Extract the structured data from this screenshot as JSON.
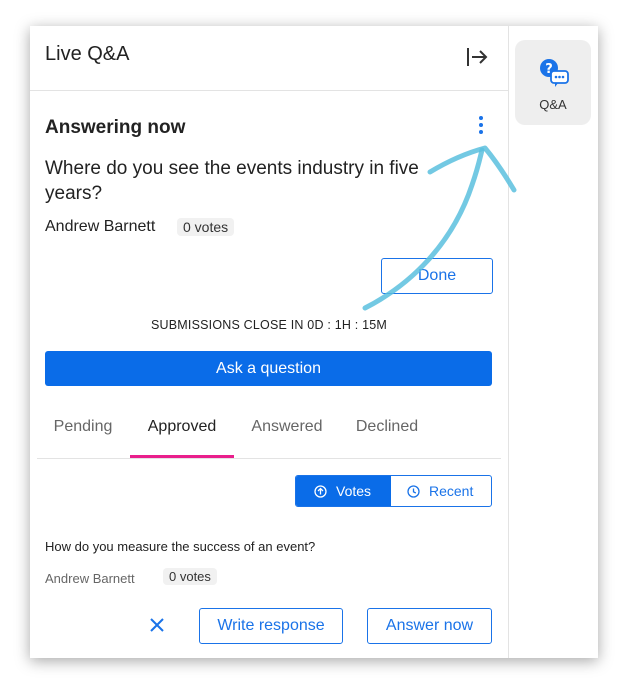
{
  "header": {
    "title": "Live Q&A"
  },
  "rail": {
    "qa_label": "Q&A",
    "icon": "qa-chat-icon"
  },
  "answering": {
    "section_title": "Answering now",
    "question": "Where do you see the events industry in five years?",
    "author": "Andrew Barnett",
    "votes": "0 votes",
    "done_label": "Done"
  },
  "submissions_close": "SUBMISSIONS CLOSE IN 0D : 1H : 15M",
  "ask_label": "Ask a question",
  "tabs": [
    {
      "label": "Pending"
    },
    {
      "label": "Approved"
    },
    {
      "label": "Answered"
    },
    {
      "label": "Declined"
    }
  ],
  "sort": {
    "votes_label": "Votes",
    "recent_label": "Recent"
  },
  "list": [
    {
      "question": "How do you measure the success of an event?",
      "author": "Andrew Barnett",
      "votes": "0 votes",
      "write_label": "Write response",
      "answer_label": "Answer now"
    }
  ],
  "colors": {
    "accent": "#0a6ce8",
    "tab_indicator": "#e91e8c",
    "annotation_arrow": "#5bc0de"
  }
}
